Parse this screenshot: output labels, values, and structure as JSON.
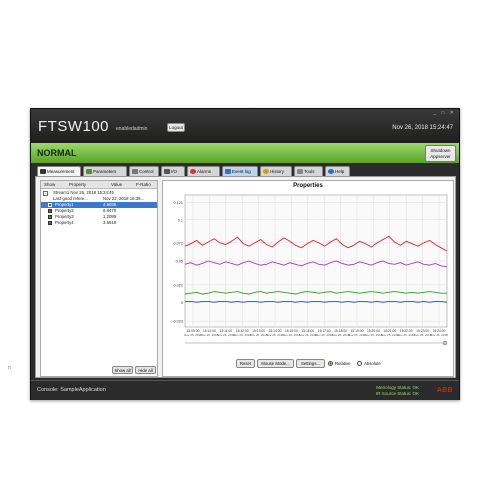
{
  "window": {
    "controls": "_ □ ✕"
  },
  "app": {
    "name": "FTSW100",
    "user": "enabledadmin",
    "logout_label": "Logout",
    "datetime": "Nov 26, 2018  15:24:47"
  },
  "status": {
    "text": "NORMAL",
    "shutdown_label_1": "Shutdown",
    "shutdown_label_2": "Appserver",
    "color": "#6fbb3a"
  },
  "tabs": [
    {
      "label": "Measurement",
      "icon": "measurement-icon"
    },
    {
      "label": "Parameters",
      "icon": "parameters-icon"
    },
    {
      "label": "Control",
      "icon": "control-icon"
    },
    {
      "label": "I/O",
      "icon": "io-icon"
    },
    {
      "label": "Alarms",
      "icon": "alarm-icon"
    },
    {
      "label": "Event log",
      "icon": "event-log-icon"
    },
    {
      "label": "History",
      "icon": "history-icon"
    },
    {
      "label": "Tools",
      "icon": "tools-icon"
    },
    {
      "label": "Help",
      "icon": "help-icon"
    }
  ],
  "table": {
    "headers": {
      "show": "Show",
      "property": "Property",
      "value": "Value",
      "fratio": "F-Ratio"
    },
    "stream": {
      "label": "Stream1  Nov 26, 2018  15:24:45"
    },
    "last_ref": {
      "label": "Last good refere...",
      "value": "Nov 22, 2018  16:39..."
    },
    "rows": [
      {
        "name": "Property1",
        "value": "4.5035",
        "color": "#2b56c9"
      },
      {
        "name": "Property2",
        "value": "8.8470",
        "color": "#d92a2a"
      },
      {
        "name": "Property3",
        "value": "1.2089",
        "color": "#2b9c2b"
      },
      {
        "name": "Property4",
        "value": "3.6919",
        "color": "#a23aa2"
      }
    ],
    "show_all": "Show all",
    "hide_all": "Hide all"
  },
  "chart_panel": {
    "title": "Properties",
    "reset": "Reset",
    "mouse_mode": "Mouse Mode...",
    "settings": "Settings...",
    "relative": "Relative",
    "absolute": "Absolute",
    "relative_selected": true
  },
  "chart_data": {
    "type": "line",
    "title": "Properties",
    "ylim": [
      -0.03,
      0.13
    ],
    "y_ticks": [
      "0.121",
      "0.1",
      "0.072",
      "0.05",
      "0.021",
      "0",
      "-0.023"
    ],
    "x_ticks": [
      "15:09:00\nNov 26, 2018",
      "15:10:00\nNov 26, 2018",
      "15:11:00\nNov 26, 2018",
      "15:12:00\nNov 26, 2018",
      "15:13:00\nNov 26, 2018",
      "15:14:00\nNov 26, 2018",
      "15:15:00\nNov 26, 2018",
      "15:16:00\nNov 26, 2018",
      "15:17:00\nNov 26, 2018",
      "15:18:00\nNov 26, 2018",
      "15:19:00\nNov 26, 2018",
      "15:20:00\nNov 26, 2018",
      "15:21:00\nNov 26, 2018",
      "15:22:00\nNov 26, 2018",
      "15:23:00\nNov 26, 2018",
      "15:24:00\nNov 26, 2018"
    ],
    "grid": true,
    "series": [
      {
        "color": "#e22222",
        "values": [
          0.068,
          0.071,
          0.075,
          0.069,
          0.073,
          0.077,
          0.072,
          0.07,
          0.074,
          0.079,
          0.071,
          0.068,
          0.072,
          0.076,
          0.07,
          0.067,
          0.073,
          0.078,
          0.074,
          0.069,
          0.066,
          0.071,
          0.075,
          0.072,
          0.068,
          0.073,
          0.077,
          0.07,
          0.066,
          0.069,
          0.074,
          0.071,
          0.067,
          0.072,
          0.076,
          0.08,
          0.073,
          0.069,
          0.074,
          0.071,
          0.068,
          0.072,
          0.075,
          0.07,
          0.066,
          0.062
        ]
      },
      {
        "color": "#b03ab0",
        "values": [
          0.046,
          0.048,
          0.045,
          0.047,
          0.05,
          0.048,
          0.046,
          0.049,
          0.047,
          0.045,
          0.048,
          0.05,
          0.047,
          0.045,
          0.046,
          0.049,
          0.047,
          0.045,
          0.048,
          0.046,
          0.044,
          0.047,
          0.049,
          0.046,
          0.045,
          0.048,
          0.05,
          0.047,
          0.045,
          0.046,
          0.049,
          0.047,
          0.045,
          0.048,
          0.05,
          0.047,
          0.046,
          0.048,
          0.045,
          0.047,
          0.049,
          0.046,
          0.045,
          0.047,
          0.044,
          0.043
        ]
      },
      {
        "color": "#2e9a2e",
        "values": [
          0.01,
          0.011,
          0.012,
          0.01,
          0.011,
          0.013,
          0.012,
          0.011,
          0.012,
          0.013,
          0.011,
          0.01,
          0.012,
          0.013,
          0.011,
          0.012,
          0.013,
          0.012,
          0.011,
          0.01,
          0.012,
          0.013,
          0.012,
          0.011,
          0.012,
          0.013,
          0.011,
          0.012,
          0.013,
          0.012,
          0.011,
          0.012,
          0.013,
          0.012,
          0.011,
          0.012,
          0.013,
          0.012,
          0.011,
          0.012,
          0.011,
          0.012,
          0.013,
          0.012,
          0.011,
          0.011
        ]
      },
      {
        "color": "#2f4fc8",
        "values": [
          0.001,
          0.001,
          0.0,
          0.001,
          0.001,
          0.0,
          0.001,
          0.001,
          0.0,
          0.001,
          0.0,
          0.001,
          0.001,
          0.0,
          0.001,
          0.001,
          0.0,
          0.001,
          0.001,
          0.0,
          0.001,
          0.0,
          0.001,
          0.001,
          0.0,
          0.001,
          0.001,
          0.0,
          0.001,
          0.0,
          0.001,
          0.001,
          0.0,
          0.001,
          0.0,
          0.001,
          0.001,
          0.0,
          0.001,
          0.001,
          0.0,
          0.001,
          0.0,
          0.001,
          0.001,
          0.0
        ]
      }
    ]
  },
  "console": {
    "text": "Console: SampleApplication",
    "metrology": "Metrology Status: OK",
    "ir_source": "IR Source Status: OK",
    "brand": "ABB"
  },
  "side_mark": "n"
}
